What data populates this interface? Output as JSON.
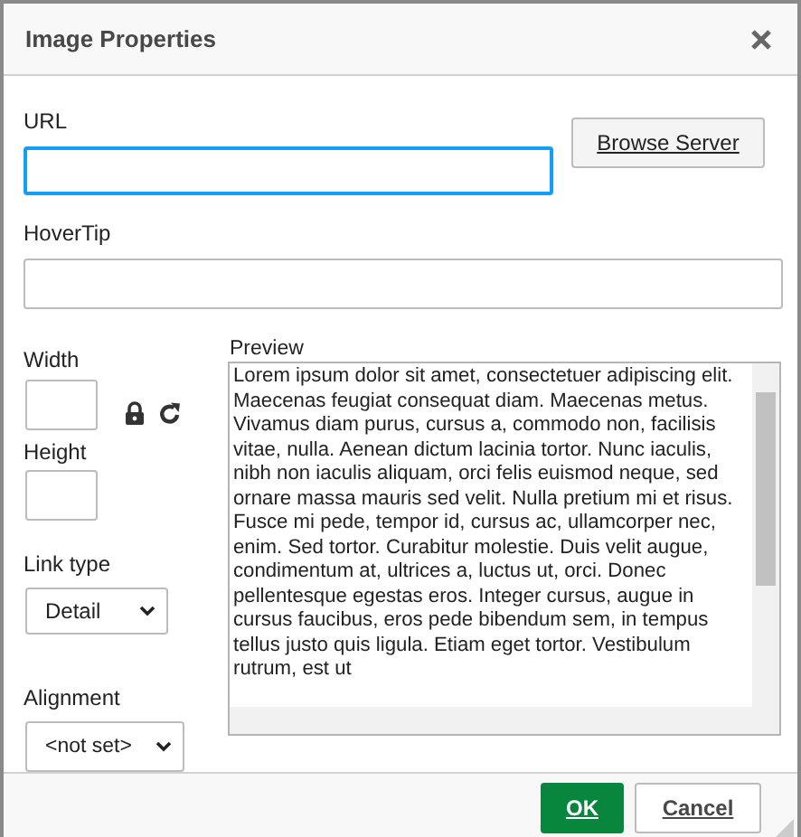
{
  "dialog": {
    "title": "Image Properties"
  },
  "url": {
    "label": "URL",
    "focused": true
  },
  "browse_button": "Browse Server",
  "hovertip": {
    "label": "HoverTip"
  },
  "width": {
    "label": "Width"
  },
  "height": {
    "label": "Height"
  },
  "link_type": {
    "label": "Link type",
    "value": "Detail"
  },
  "alignment": {
    "label": "Alignment",
    "value": "<not set>"
  },
  "preview": {
    "label": "Preview",
    "text": "Lorem ipsum dolor sit amet, consectetuer adipiscing elit. Maecenas feugiat consequat diam. Maecenas metus. Vivamus diam purus, cursus a, commodo non, facilisis vitae, nulla. Aenean dictum lacinia tortor. Nunc iaculis, nibh non iaculis aliquam, orci felis euismod neque, sed ornare massa mauris sed velit. Nulla pretium mi et risus. Fusce mi pede, tempor id, cursus ac, ullamcorper nec, enim. Sed tortor. Curabitur molestie. Duis velit augue, condimentum at, ultrices a, luctus ut, orci. Donec pellentesque egestas eros. Integer cursus, augue in cursus faucibus, eros pede bibendum sem, in tempus tellus justo quis ligula. Etiam eget tortor. Vestibulum rutrum, est ut"
  },
  "buttons": [
    {
      "label": "OK",
      "kind": "primary"
    },
    {
      "label": "Cancel",
      "kind": "secondary"
    }
  ]
}
